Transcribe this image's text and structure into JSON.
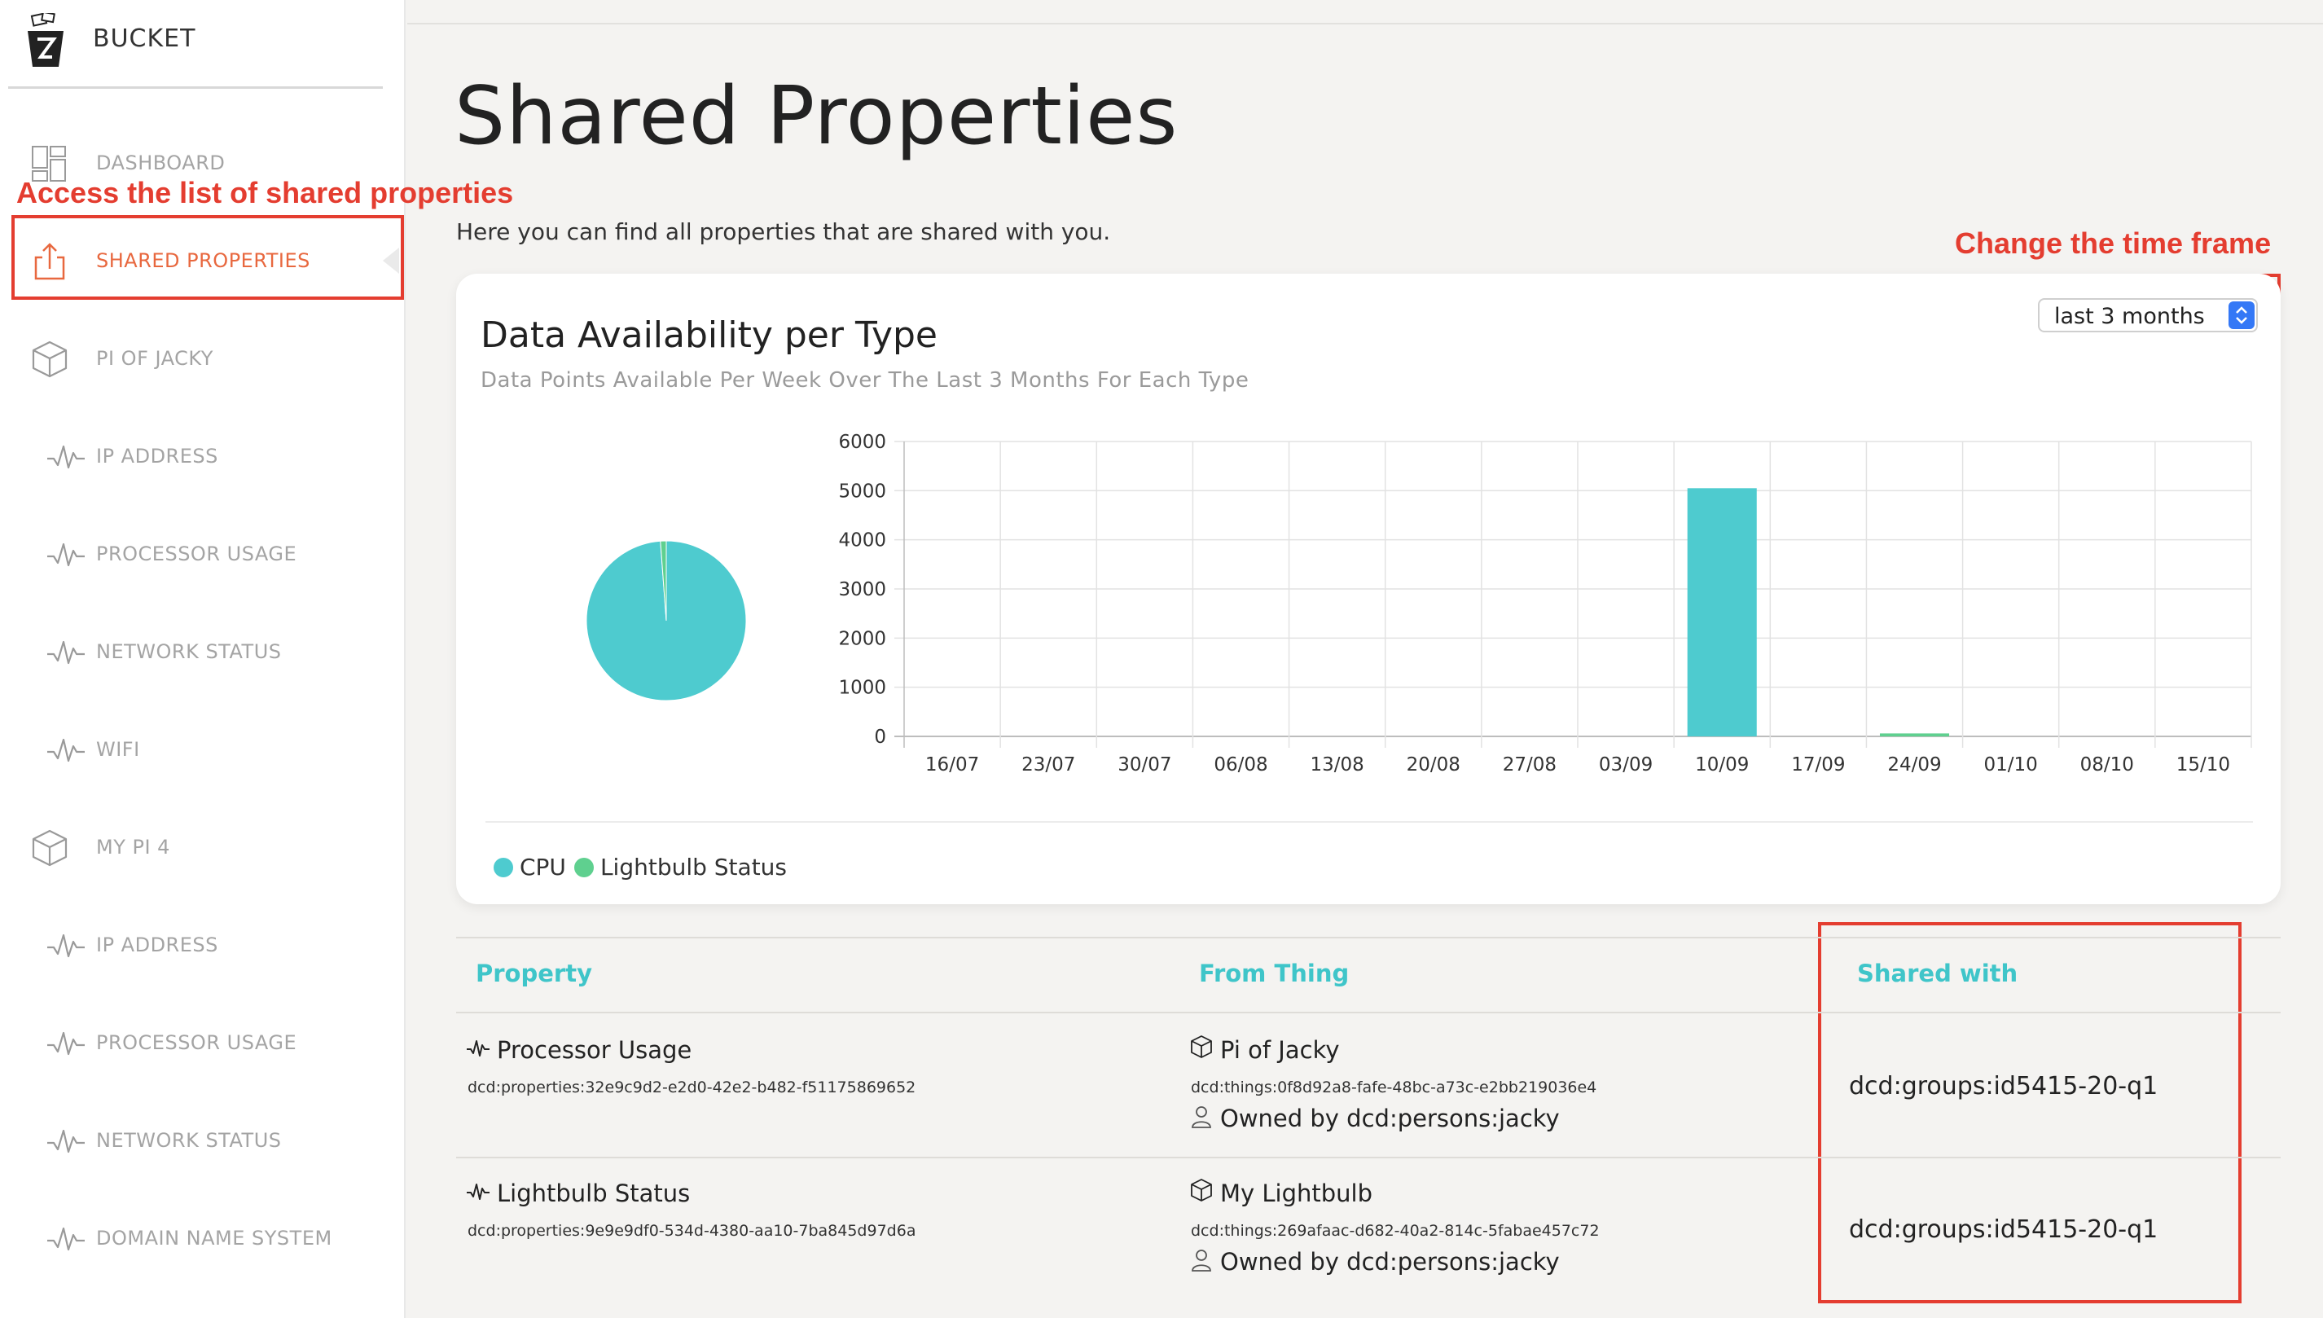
{
  "app": {
    "name": "BUCKET"
  },
  "sidebar": {
    "items": [
      {
        "label": "DASHBOARD",
        "icon": "dashboard-icon",
        "active": false
      },
      {
        "label": "SHARED PROPERTIES",
        "icon": "share-icon",
        "active": true
      },
      {
        "label": "PI OF JACKY",
        "icon": "thing-cube-icon",
        "active": false
      },
      {
        "label": "IP ADDRESS",
        "icon": "property-wave-icon",
        "active": false
      },
      {
        "label": "PROCESSOR USAGE",
        "icon": "property-wave-icon",
        "active": false
      },
      {
        "label": "NETWORK STATUS",
        "icon": "property-wave-icon",
        "active": false
      },
      {
        "label": "WIFI",
        "icon": "property-wave-icon",
        "active": false
      },
      {
        "label": "MY PI 4",
        "icon": "thing-cube-icon",
        "active": false
      },
      {
        "label": "IP ADDRESS",
        "icon": "property-wave-icon",
        "active": false
      },
      {
        "label": "PROCESSOR USAGE",
        "icon": "property-wave-icon",
        "active": false
      },
      {
        "label": "NETWORK STATUS",
        "icon": "property-wave-icon",
        "active": false
      },
      {
        "label": "DOMAIN NAME SYSTEM",
        "icon": "property-wave-icon",
        "active": false
      }
    ]
  },
  "annotations": {
    "sidebar_note": "Access the list of shared properties",
    "timeframe_note": "Change the time frame"
  },
  "page": {
    "title": "Shared Properties",
    "subtitle": "Here you can find all properties that are shared with you."
  },
  "card": {
    "title": "Data Availability per Type",
    "subtitle": "Data Points Available Per Week Over The Last 3 Months For Each Type",
    "timeframe_select": {
      "value": "last 3 months"
    },
    "legend": [
      {
        "label": "CPU",
        "color": "#4ecbcf"
      },
      {
        "label": "Lightbulb Status",
        "color": "#5fd08f"
      }
    ]
  },
  "chart_data": [
    {
      "type": "pie",
      "labels": [
        "CPU",
        "Lightbulb Status"
      ],
      "values": [
        5050,
        60
      ],
      "colors": [
        "#4ecbcf",
        "#5fd08f"
      ]
    },
    {
      "type": "bar",
      "categories": [
        "16/07",
        "23/07",
        "30/07",
        "06/08",
        "13/08",
        "20/08",
        "27/08",
        "03/09",
        "10/09",
        "17/09",
        "24/09",
        "01/10",
        "08/10",
        "15/10"
      ],
      "series": [
        {
          "name": "CPU",
          "color": "#4ecbcf",
          "values": [
            0,
            0,
            0,
            0,
            0,
            0,
            0,
            0,
            5050,
            0,
            0,
            0,
            0,
            0
          ]
        },
        {
          "name": "Lightbulb Status",
          "color": "#5fd08f",
          "values": [
            0,
            0,
            0,
            0,
            0,
            0,
            0,
            0,
            0,
            0,
            60,
            0,
            0,
            0
          ]
        }
      ],
      "stacked": true,
      "yticks": [
        "6000",
        "5000",
        "4000",
        "3000",
        "2000",
        "1000",
        "0"
      ],
      "ylim": [
        0,
        6000
      ],
      "grid": true
    }
  ],
  "table": {
    "headers": {
      "property": "Property",
      "from_thing": "From Thing",
      "shared_with": "Shared with"
    },
    "rows": [
      {
        "property_name": "Processor Usage",
        "property_id": "dcd:properties:32e9c9d2-e2d0-42e2-b482-f51175869652",
        "thing_name": "Pi of Jacky",
        "thing_id": "dcd:things:0f8d92a8-fafe-48bc-a73c-e2bb219036e4",
        "owner": "Owned by dcd:persons:jacky",
        "shared_with": "dcd:groups:id5415-20-q1"
      },
      {
        "property_name": "Lightbulb Status",
        "property_id": "dcd:properties:9e9e9df0-534d-4380-aa10-7ba845d97d6a",
        "thing_name": "My Lightbulb",
        "thing_id": "dcd:things:269afaac-d682-40a2-814c-5fabae457c72",
        "owner": "Owned by dcd:persons:jacky",
        "shared_with": "dcd:groups:id5415-20-q1"
      }
    ]
  }
}
